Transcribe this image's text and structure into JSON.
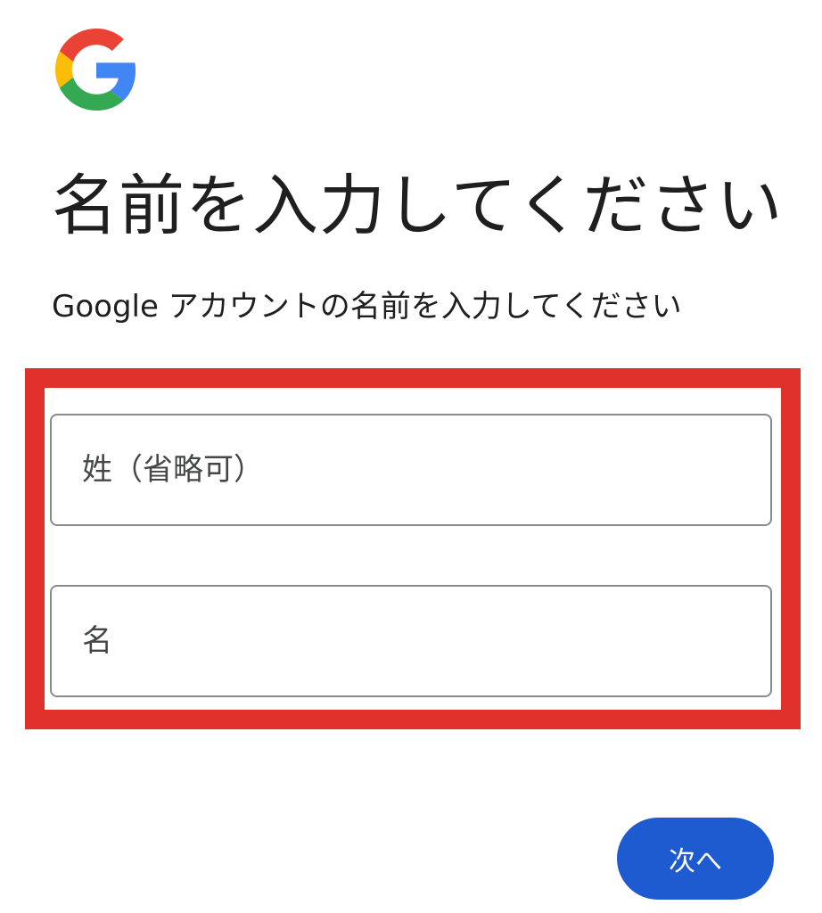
{
  "logo": {
    "icon": "google-g-logo",
    "colors": {
      "blue": "#4285F4",
      "red": "#EA4335",
      "yellow": "#FBBC05",
      "green": "#34A853"
    }
  },
  "header": {
    "title": "名前を入力してください",
    "subtitle": "Google アカウントの名前を入力してください"
  },
  "form": {
    "last_name": {
      "value": "",
      "placeholder": "姓（省略可）"
    },
    "first_name": {
      "value": "",
      "placeholder": "名"
    },
    "highlight_color": "#E0312A"
  },
  "actions": {
    "next_label": "次へ",
    "next_color": "#1F5BD0"
  }
}
